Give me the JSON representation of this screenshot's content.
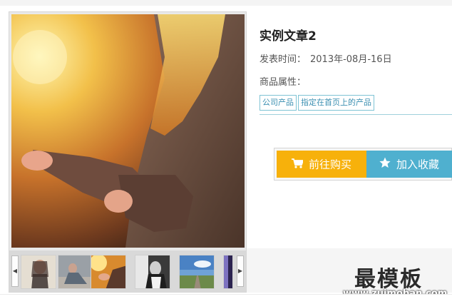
{
  "product": {
    "title": "实例文章2",
    "publish_label": "发表时间：",
    "publish_date": "2013年-08月-16日",
    "attributes_label": "商品属性：",
    "tags": [
      "公司产品",
      "指定在首页上的产品"
    ]
  },
  "actions": {
    "buy_label": "前往购买",
    "buy_icon": "cart-icon",
    "favorite_label": "加入收藏",
    "favorite_icon": "star-icon"
  },
  "gallery": {
    "main_image": "girl-in-sunlight-photo",
    "thumbnails": [
      "thumb-girl-portrait",
      "thumb-girl-sitting",
      "thumb-sunlight-hands",
      "thumb-bw-girl",
      "thumb-road-sky",
      "thumb-dark-partial"
    ],
    "prev_icon": "chevron-left-icon",
    "next_icon": "chevron-right-icon"
  },
  "watermark": {
    "name": "最模板",
    "url": "www.zuimoban.com"
  },
  "colors": {
    "buy": "#f7b10b",
    "favorite": "#4fb0cf",
    "tag_text": "#3b8fb1",
    "tag_border": "#7ec3d4"
  }
}
